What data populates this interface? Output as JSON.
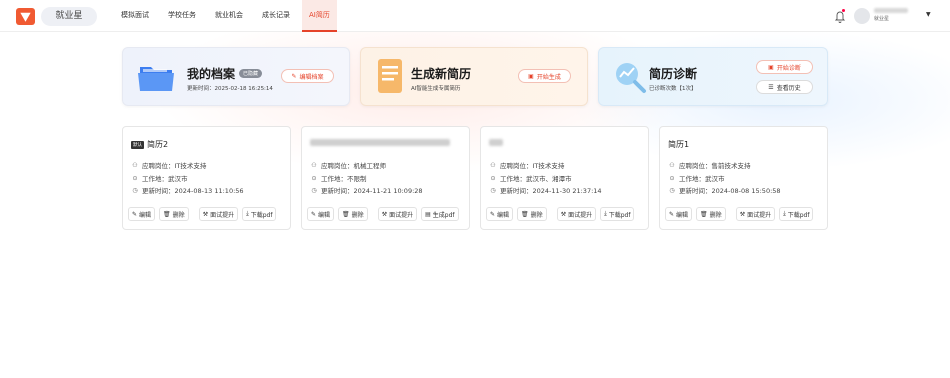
{
  "brand": {
    "name": "就业星",
    "logo_icon": "star-logo-icon",
    "accent": "#f05a32"
  },
  "nav": [
    {
      "label": "模拟面试",
      "active": false
    },
    {
      "label": "学校任务",
      "active": false
    },
    {
      "label": "就业机会",
      "active": false
    },
    {
      "label": "成长记录",
      "active": false
    },
    {
      "label": "AI简历",
      "active": true
    }
  ],
  "user": {
    "subtitle": "就业星"
  },
  "hero": {
    "archive": {
      "title": "我的档案",
      "badge": "已隐藏",
      "updated": "更新时间：2025-02-18 16:25:14",
      "button": "编辑档案"
    },
    "generate": {
      "title": "生成新简历",
      "subtitle": "AI智能生成专属简历",
      "button": "开始生成"
    },
    "diagnose": {
      "title": "简历诊断",
      "subtitle": "已诊断次数【1次】",
      "button_start": "开始诊断",
      "button_history": "查看历史"
    }
  },
  "resumes": [
    {
      "tag": "默认",
      "title": "简历2",
      "position": "应聘岗位：IT技术支持",
      "location": "工作地：武汉市",
      "updated": "更新时间：2024-08-13 11:10:56",
      "actions": [
        "编辑",
        "删除",
        "面试提升",
        "下载pdf"
      ]
    },
    {
      "tag": "",
      "title": "",
      "position": "应聘岗位：机械工程师",
      "location": "工作地：不限制",
      "updated": "更新时间：2024-11-21 10:09:28",
      "actions": [
        "编辑",
        "删除",
        "面试提升",
        "生成pdf"
      ]
    },
    {
      "tag": "",
      "title": "",
      "position": "应聘岗位：IT技术支持",
      "location": "工作地：武汉市、湘潭市",
      "updated": "更新时间：2024-11-30 21:37:14",
      "actions": [
        "编辑",
        "删除",
        "面试提升",
        "下载pdf"
      ]
    },
    {
      "tag": "",
      "title": "简历1",
      "position": "应聘岗位：售前技术支持",
      "location": "工作地：武汉市",
      "updated": "更新时间：2024-08-08 15:50:58",
      "actions": [
        "编辑",
        "删除",
        "面试提升",
        "下载pdf"
      ]
    }
  ]
}
